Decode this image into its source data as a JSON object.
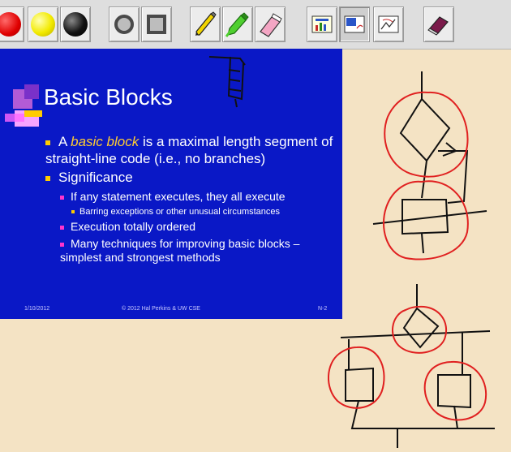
{
  "slide": {
    "title": "Basic Blocks",
    "bullet1_pre": "A ",
    "bullet1_em": "basic block",
    "bullet1_post": " is a maximal length segment of straight-line code (i.e., no branches)",
    "bullet2": "Significance",
    "sub1": "If any statement executes, they all execute",
    "subsub1": "Barring exceptions or other unusual circumstances",
    "sub2": "Execution totally ordered",
    "sub3": "Many techniques for improving basic blocks – simplest and strongest methods",
    "footer_date": "1/10/2012",
    "footer_center": "© 2012 Hal Perkins & UW CSE",
    "footer_page": "N-2"
  },
  "toolbar": {
    "tools": [
      "red-color",
      "yellow-color",
      "black-color",
      "hollow-circle",
      "hollow-square",
      "pencil",
      "highlighter",
      "eraser",
      "view-slide-only",
      "view-slide-and-ink",
      "view-ink-only",
      "clear"
    ]
  },
  "colors": {
    "slide_bg": "#0a18c6",
    "canvas_bg": "#f4e3c4",
    "ink_red": "#e02020",
    "ink_black": "#111111"
  }
}
